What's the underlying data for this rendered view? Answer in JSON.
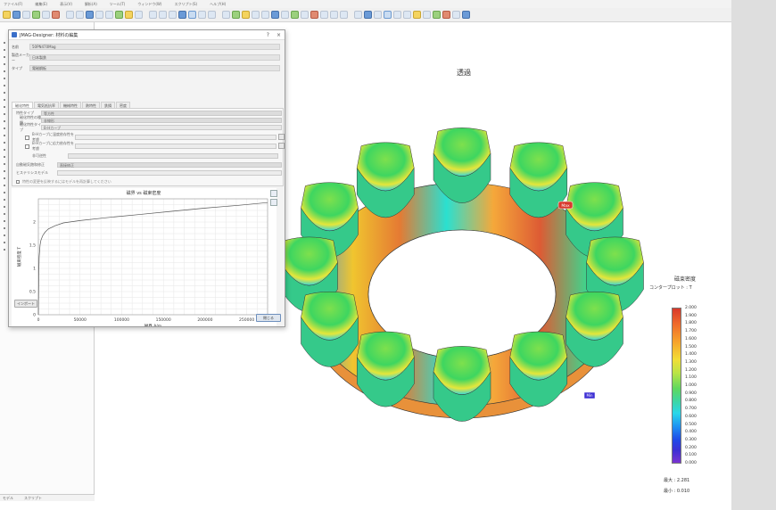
{
  "menu": [
    "ファイル(F)",
    "編集(E)",
    "表示(V)",
    "解析(A)",
    "ツール(T)",
    "ウィンドウ(W)",
    "スクリプト(S)",
    "ヘルプ(H)"
  ],
  "statusbar": {
    "left": "モデル",
    "right": "スクリプト"
  },
  "viewport": {
    "title": "透過"
  },
  "dialog": {
    "title": "JMAG-Designer: 材料の編集",
    "fields": [
      {
        "label": "名前",
        "value": "50PN470Mag"
      },
      {
        "label": "製造メーカー",
        "value": "日本製鉄"
      },
      {
        "label": "タイプ",
        "value": "電磁鋼板"
      }
    ],
    "tabs": [
      "磁化特性",
      "電気抵抗率",
      "機械特性",
      "熱特性",
      "鉄損",
      "密度"
    ],
    "active_tab": "磁化特性",
    "properties": [
      {
        "label": "特性タイプ",
        "value": "等方性"
      },
      {
        "label": "磁化特性の種類",
        "value": "非線形"
      },
      {
        "label": "磁化特性タイプ",
        "value": "B-Hカーブ"
      },
      {
        "label": "B-Hカーブに温度依存性を考慮",
        "value": "",
        "checkbox": true
      },
      {
        "label": "B-Hカーブに応力依存性を考慮",
        "value": "",
        "checkbox": true
      },
      {
        "label": "非可逆性",
        "value": ""
      },
      {
        "label": "自動磁気飽和修正",
        "value": "直接修正"
      },
      {
        "label": "ヒステリシスモデル",
        "value": ""
      }
    ],
    "note": "特性の変更を反映するにはモデルを再計算してください",
    "chart": {
      "title": "磁界 vs 磁束密度",
      "import_btn": "インポート",
      "close_btn": "閉じる"
    }
  },
  "chart_data": {
    "type": "line",
    "title": "磁界 vs 磁束密度",
    "xlabel": "磁界 A/m",
    "ylabel": "磁束密度 T",
    "xlim": [
      0,
      275000
    ],
    "ylim": [
      0,
      2.5
    ],
    "x_ticks": [
      0,
      50000,
      100000,
      150000,
      200000,
      250000
    ],
    "y_ticks": [
      0,
      0.5,
      1,
      1.5,
      2
    ],
    "grid": true,
    "series": [
      {
        "x": [
          0,
          500,
          1000,
          2000,
          3000,
          5000,
          8000,
          12000,
          20000,
          30000,
          50000,
          80000,
          120000,
          160000,
          200000,
          240000,
          275000
        ],
        "values": [
          0,
          0.9,
          1.25,
          1.5,
          1.6,
          1.7,
          1.78,
          1.85,
          1.92,
          1.98,
          2.03,
          2.09,
          2.16,
          2.23,
          2.3,
          2.36,
          2.42
        ]
      }
    ]
  },
  "legend": {
    "title": "磁束密度",
    "subtitle": "コンタープロット : T",
    "ticks": [
      "2.000",
      "1.900",
      "1.800",
      "1.700",
      "1.600",
      "1.500",
      "1.400",
      "1.300",
      "1.200",
      "1.100",
      "1.000",
      "0.900",
      "0.800",
      "0.700",
      "0.600",
      "0.500",
      "0.400",
      "0.300",
      "0.200",
      "0.100",
      "0.000"
    ],
    "max": "最大 : 2.281",
    "min": "最小 : 0.010"
  },
  "markers": {
    "max_tag": "Max",
    "min_tag": "Min"
  },
  "colors": {
    "accent": "#3a6fc9"
  }
}
